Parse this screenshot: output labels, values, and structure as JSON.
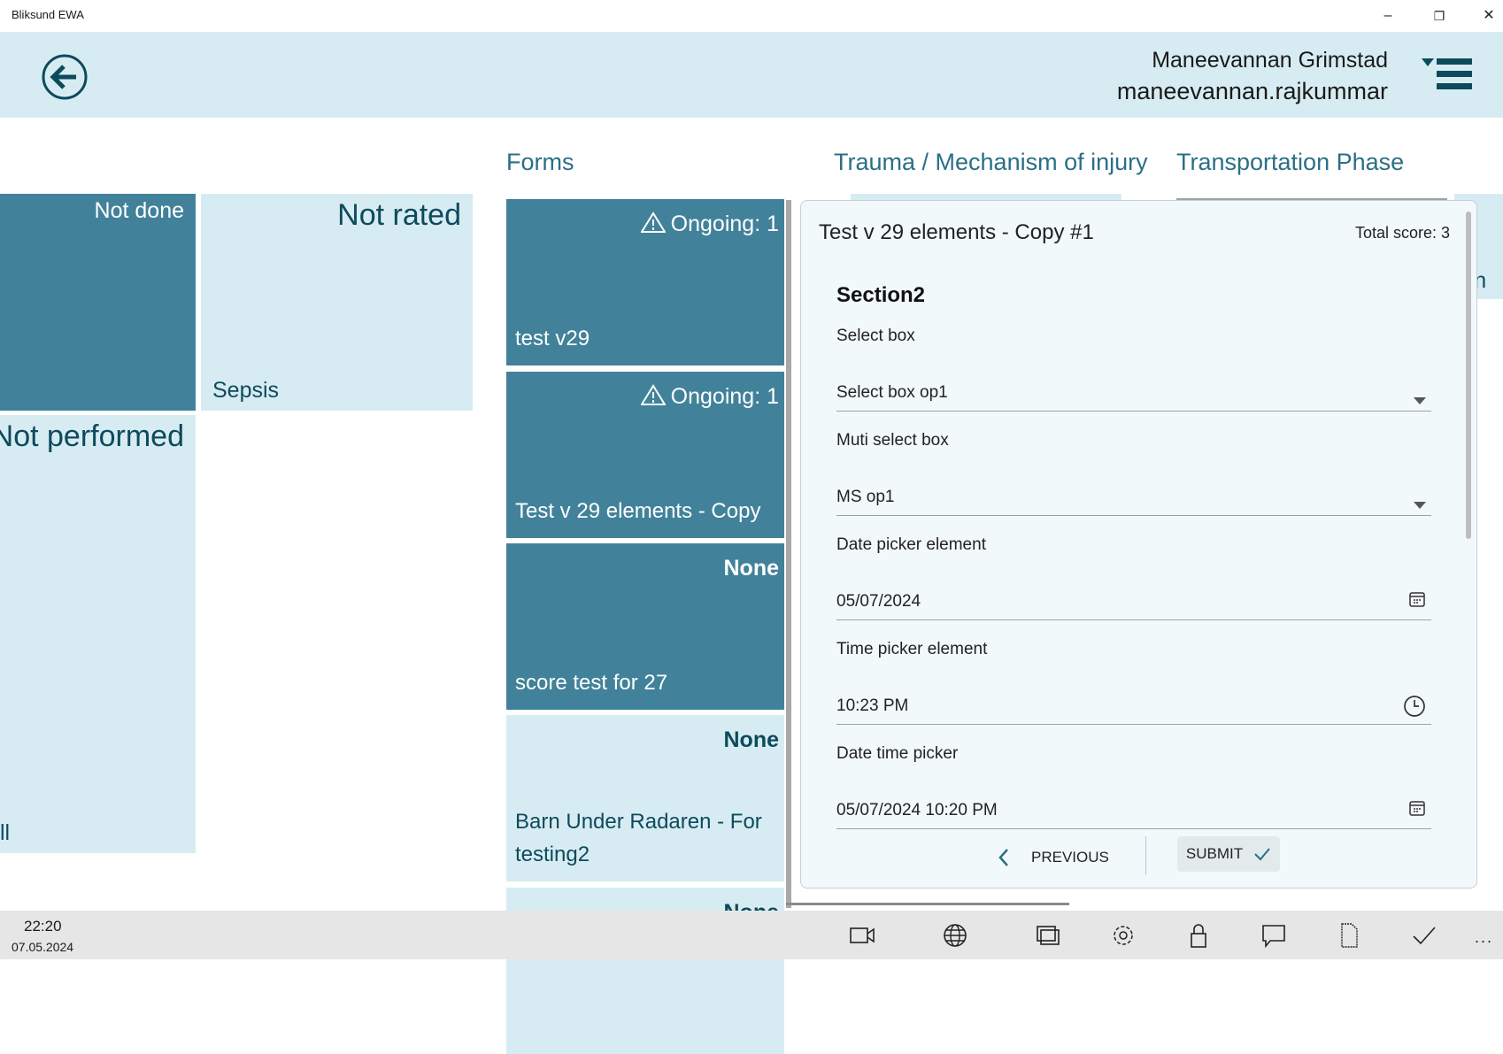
{
  "window": {
    "title": "Bliksund EWA",
    "controls": [
      "minimize",
      "restore",
      "close"
    ]
  },
  "header": {
    "user_name": "Maneevannan Grimstad",
    "username": "maneevannan.rajkummar",
    "back_icon": "arrow-left-circle-icon",
    "menu_icon": "hamburger-menu-icon"
  },
  "tabs": [
    {
      "label": "Forms"
    },
    {
      "label": "Trauma / Mechanism of injury"
    },
    {
      "label": "Transportation Phase"
    }
  ],
  "left_tiles": {
    "not_done": "Not done",
    "not_rated": "Not rated",
    "sepsis": "Sepsis",
    "not_performed": "Not performed",
    "partial": "ll",
    "right_partial": "ran"
  },
  "form_cards": [
    {
      "status": "Ongoing: 1",
      "name": "test v29",
      "warning": true,
      "style": "dark"
    },
    {
      "status": "Ongoing: 1",
      "name": "Test v 29 elements - Copy",
      "warning": true,
      "style": "dark"
    },
    {
      "status": "None",
      "name": "score test for 27",
      "warning": false,
      "style": "dark"
    },
    {
      "status": "None",
      "name": "Barn Under Radaren - For testing2",
      "warning": false,
      "style": "light"
    },
    {
      "status": "None",
      "name": "",
      "warning": false,
      "style": "light"
    }
  ],
  "panel": {
    "title": "Test v 29 elements - Copy #1",
    "total_score": "Total score: 3",
    "section": "Section2",
    "fields": [
      {
        "label": "Select box",
        "value": "Select box op1",
        "icon": "dropdown-arrow-icon"
      },
      {
        "label": "Muti select box",
        "value": "MS op1",
        "icon": "dropdown-arrow-icon"
      },
      {
        "label": "Date picker element",
        "value": "05/07/2024",
        "icon": "calendar-icon"
      },
      {
        "label": "Time picker element",
        "value": "10:23 PM",
        "icon": "clock-icon"
      },
      {
        "label": "Date time picker",
        "value": "05/07/2024 10:20 PM",
        "icon": "calendar-icon"
      }
    ],
    "previous_label": "PREVIOUS",
    "submit_label": "SUBMIT"
  },
  "taskbar": {
    "time": "22:20",
    "date": "07.05.2024",
    "icons": [
      "video-camera-icon",
      "globe-icon",
      "windows-icon",
      "gear-icon",
      "lock-icon",
      "chat-icon",
      "document-icon",
      "check-icon",
      "more-icon"
    ],
    "more": "..."
  },
  "colors": {
    "header_bg": "#d7ecf2",
    "tile_dark": "#41829a",
    "tile_light": "#d7ecf2",
    "text_dark": "#0d4a5c",
    "accent": "#2a6f86"
  }
}
